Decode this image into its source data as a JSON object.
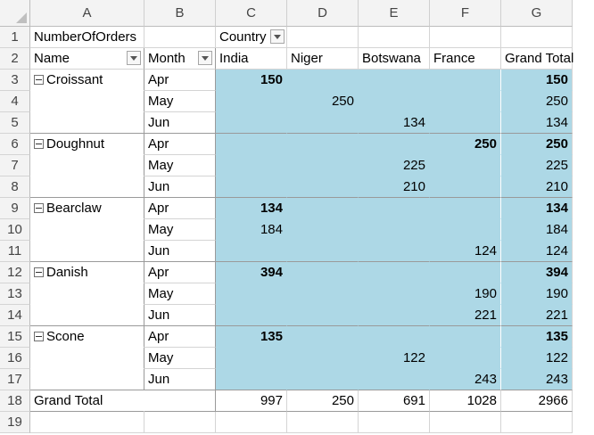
{
  "columns": [
    "A",
    "B",
    "C",
    "D",
    "E",
    "F",
    "G"
  ],
  "rows": [
    "1",
    "2",
    "3",
    "4",
    "5",
    "6",
    "7",
    "8",
    "9",
    "10",
    "11",
    "12",
    "13",
    "14",
    "15",
    "16",
    "17",
    "18",
    "19"
  ],
  "pivot": {
    "value_field": "NumberOfOrders",
    "column_field": "Country",
    "row_field_name": "Name",
    "row_field_month": "Month",
    "countries": [
      "India",
      "Niger",
      "Botswana",
      "France"
    ],
    "grand_total_label": "Grand Total",
    "groups": [
      {
        "name": "Croissant",
        "rows": [
          {
            "month": "Apr",
            "values": [
              "150",
              "",
              "",
              ""
            ],
            "total": "150"
          },
          {
            "month": "May",
            "values": [
              "",
              "250",
              "",
              ""
            ],
            "total": "250"
          },
          {
            "month": "Jun",
            "values": [
              "",
              "",
              "134",
              ""
            ],
            "total": "134"
          }
        ]
      },
      {
        "name": "Doughnut",
        "rows": [
          {
            "month": "Apr",
            "values": [
              "",
              "",
              "",
              "250"
            ],
            "total": "250"
          },
          {
            "month": "May",
            "values": [
              "",
              "",
              "225",
              ""
            ],
            "total": "225"
          },
          {
            "month": "Jun",
            "values": [
              "",
              "",
              "210",
              ""
            ],
            "total": "210"
          }
        ]
      },
      {
        "name": "Bearclaw",
        "rows": [
          {
            "month": "Apr",
            "values": [
              "134",
              "",
              "",
              ""
            ],
            "total": "134"
          },
          {
            "month": "May",
            "values": [
              "184",
              "",
              "",
              ""
            ],
            "total": "184"
          },
          {
            "month": "Jun",
            "values": [
              "",
              "",
              "",
              "124"
            ],
            "total": "124"
          }
        ]
      },
      {
        "name": "Danish",
        "rows": [
          {
            "month": "Apr",
            "values": [
              "394",
              "",
              "",
              ""
            ],
            "total": "394"
          },
          {
            "month": "May",
            "values": [
              "",
              "",
              "",
              "190"
            ],
            "total": "190"
          },
          {
            "month": "Jun",
            "values": [
              "",
              "",
              "",
              "221"
            ],
            "total": "221"
          }
        ]
      },
      {
        "name": "Scone",
        "rows": [
          {
            "month": "Apr",
            "values": [
              "135",
              "",
              "",
              ""
            ],
            "total": "135"
          },
          {
            "month": "May",
            "values": [
              "",
              "",
              "122",
              ""
            ],
            "total": "122"
          },
          {
            "month": "Jun",
            "values": [
              "",
              "",
              "",
              "243"
            ],
            "total": "243"
          }
        ]
      }
    ],
    "grand_totals": [
      "997",
      "250",
      "691",
      "1028"
    ],
    "grand_total_all": "2966"
  },
  "icons": {
    "filter": "filter-dropdown-icon",
    "collapse": "collapse-minus-icon"
  },
  "colors": {
    "highlight": "#add8e6"
  }
}
